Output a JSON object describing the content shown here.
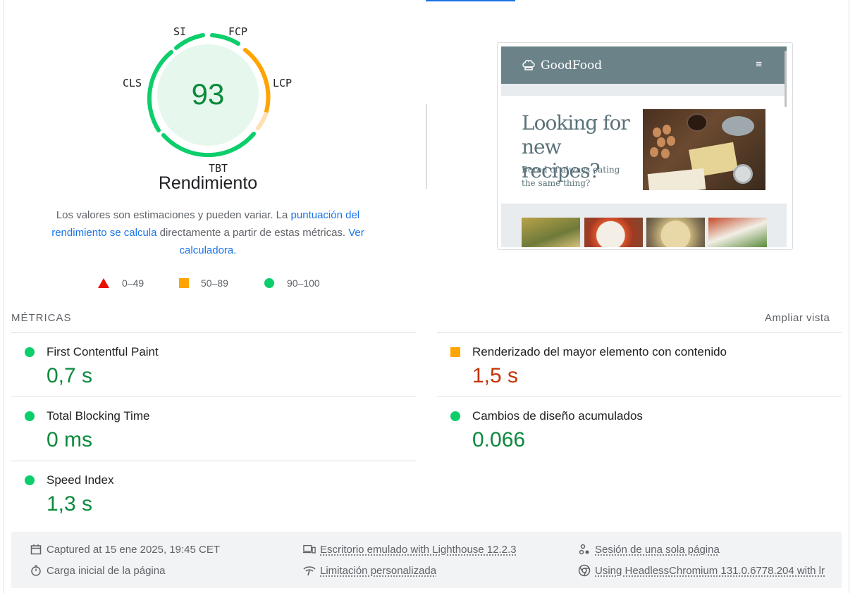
{
  "gauge": {
    "score": "93",
    "title": "Rendimiento",
    "labels": {
      "si": "SI",
      "fcp": "FCP",
      "lcp": "LCP",
      "cls": "CLS",
      "tbt": "TBT"
    }
  },
  "description": {
    "text1": "Los valores son estimaciones y pueden variar. La ",
    "link1": "puntuación del rendimiento se calcula",
    "text2": " directamente a partir de estas métricas. ",
    "link2": "Ver calculadora."
  },
  "legend": [
    {
      "shape": "triangle",
      "label": "0–49",
      "color": "#eb0f00"
    },
    {
      "shape": "square",
      "label": "50–89",
      "color": "#ffa400"
    },
    {
      "shape": "circle",
      "label": "90–100",
      "color": "#0cce6b"
    }
  ],
  "preview": {
    "brand": "GoodFood",
    "menu_icon": "≡",
    "headline": "Looking for new recipes?",
    "subheadline": "Bored of always eating the same thing?"
  },
  "metrics_section": {
    "title": "MÉTRICAS",
    "expand_label": "Ampliar vista"
  },
  "metrics": [
    {
      "name": "First Contentful Paint",
      "value": "0,7 s",
      "rating": "good"
    },
    {
      "name": "Renderizado del mayor elemento con contenido",
      "value": "1,5 s",
      "rating": "average"
    },
    {
      "name": "Total Blocking Time",
      "value": "0 ms",
      "rating": "good"
    },
    {
      "name": "Cambios de diseño acumulados",
      "value": "0.066",
      "rating": "good"
    },
    {
      "name": "Speed Index",
      "value": "1,3 s",
      "rating": "good"
    }
  ],
  "footer": {
    "captured": "Captured at 15 ene 2025, 19:45 CET",
    "load_type": "Carga inicial de la página",
    "device": "Escritorio emulado with Lighthouse 12.2.3",
    "throttling": "Limitación personalizada",
    "session": "Sesión de una sola página",
    "browser": "Using HeadlessChromium 131.0.6778.204 with lr"
  },
  "colors": {
    "good": "#0cce6b",
    "good_text": "#0c8a3c",
    "average": "#ffa400",
    "average_text": "#c33300",
    "poor": "#eb0f00",
    "link": "#1a73e8"
  }
}
